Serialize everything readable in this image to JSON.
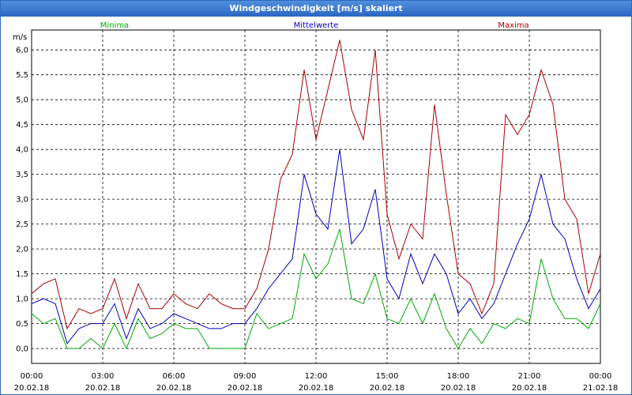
{
  "window": {
    "title": "Windgeschwindigkeit [m/s] skaliert"
  },
  "colors": {
    "minima": "#00aa00",
    "mittel": "#0000bb",
    "maxima": "#aa0000",
    "titlebar": "#2a66c3"
  },
  "chart_data": {
    "type": "line",
    "title": "Windgeschwindigkeit [m/s] skaliert",
    "ylabel": "m/s",
    "xlabel": "",
    "ylim": [
      -0.3,
      6.4
    ],
    "xlim": [
      0,
      24
    ],
    "grid": true,
    "legend_position": "top",
    "y_ticks": [
      "0,0",
      "0,5",
      "1,0",
      "1,5",
      "2,0",
      "2,5",
      "3,0",
      "3,5",
      "4,0",
      "4,5",
      "5,0",
      "5,5",
      "6,0"
    ],
    "y_tick_values": [
      0,
      0.5,
      1.0,
      1.5,
      2.0,
      2.5,
      3.0,
      3.5,
      4.0,
      4.5,
      5.0,
      5.5,
      6.0
    ],
    "x_ticks": [
      {
        "time": "00:00",
        "date": "20.02.18"
      },
      {
        "time": "03:00",
        "date": "20.02.18"
      },
      {
        "time": "06:00",
        "date": "20.02.18"
      },
      {
        "time": "09:00",
        "date": "20.02.18"
      },
      {
        "time": "12:00",
        "date": "20.02.18"
      },
      {
        "time": "15:00",
        "date": "20.02.18"
      },
      {
        "time": "18:00",
        "date": "20.02.18"
      },
      {
        "time": "21:00",
        "date": "20.02.18"
      },
      {
        "time": "00:00",
        "date": "21.02.18"
      }
    ],
    "x_tick_values": [
      0,
      3,
      6,
      9,
      12,
      15,
      18,
      21,
      24
    ],
    "series": [
      {
        "name": "Minima",
        "x": [
          0,
          0.5,
          1,
          1.5,
          2,
          2.5,
          3,
          3.5,
          4,
          4.5,
          5,
          5.5,
          6,
          6.5,
          7,
          7.5,
          8,
          8.5,
          9,
          9.5,
          10,
          10.5,
          11,
          11.5,
          12,
          12.5,
          13,
          13.5,
          14,
          14.5,
          15,
          15.5,
          16,
          16.5,
          17,
          17.5,
          18,
          18.5,
          19,
          19.5,
          20,
          20.5,
          21,
          21.5,
          22,
          22.5,
          23,
          23.5,
          24
        ],
        "values": [
          0.7,
          0.5,
          0.6,
          0.0,
          0.0,
          0.2,
          0.0,
          0.5,
          0.0,
          0.6,
          0.2,
          0.3,
          0.5,
          0.4,
          0.4,
          0.0,
          0.0,
          0.0,
          0.0,
          0.7,
          0.4,
          0.5,
          0.6,
          1.9,
          1.4,
          1.7,
          2.4,
          1.0,
          0.9,
          1.5,
          0.6,
          0.5,
          1.0,
          0.5,
          1.1,
          0.4,
          0.0,
          0.4,
          0.1,
          0.5,
          0.4,
          0.6,
          0.5,
          1.8,
          1.0,
          0.6,
          0.6,
          0.4,
          0.9
        ]
      },
      {
        "name": "Mittelwerte",
        "x": [
          0,
          0.5,
          1,
          1.5,
          2,
          2.5,
          3,
          3.5,
          4,
          4.5,
          5,
          5.5,
          6,
          6.5,
          7,
          7.5,
          8,
          8.5,
          9,
          9.5,
          10,
          10.5,
          11,
          11.5,
          12,
          12.5,
          13,
          13.5,
          14,
          14.5,
          15,
          15.5,
          16,
          16.5,
          17,
          17.5,
          18,
          18.5,
          19,
          19.5,
          20,
          20.5,
          21,
          21.5,
          22,
          22.5,
          23,
          23.5,
          24
        ],
        "values": [
          0.9,
          1.0,
          0.9,
          0.1,
          0.4,
          0.5,
          0.5,
          0.9,
          0.2,
          0.8,
          0.4,
          0.5,
          0.7,
          0.6,
          0.5,
          0.4,
          0.4,
          0.5,
          0.5,
          0.8,
          1.2,
          1.5,
          1.8,
          3.5,
          2.7,
          2.4,
          4.0,
          2.1,
          2.4,
          3.2,
          1.4,
          1.0,
          1.9,
          1.3,
          1.9,
          1.5,
          0.7,
          1.0,
          0.6,
          0.9,
          1.5,
          2.1,
          2.6,
          3.5,
          2.5,
          2.2,
          1.4,
          0.8,
          1.2
        ]
      },
      {
        "name": "Maxima",
        "x": [
          0,
          0.5,
          1,
          1.5,
          2,
          2.5,
          3,
          3.5,
          4,
          4.5,
          5,
          5.5,
          6,
          6.5,
          7,
          7.5,
          8,
          8.5,
          9,
          9.5,
          10,
          10.5,
          11,
          11.5,
          12,
          12.5,
          13,
          13.5,
          14,
          14.5,
          15,
          15.5,
          16,
          16.5,
          17,
          17.5,
          18,
          18.5,
          19,
          19.5,
          20,
          20.5,
          21,
          21.5,
          22,
          22.5,
          23,
          23.5,
          24
        ],
        "values": [
          1.1,
          1.3,
          1.4,
          0.4,
          0.8,
          0.7,
          0.8,
          1.4,
          0.6,
          1.3,
          0.8,
          0.8,
          1.1,
          0.9,
          0.8,
          1.1,
          0.9,
          0.8,
          0.8,
          1.2,
          2.0,
          3.4,
          3.9,
          5.6,
          4.2,
          5.2,
          6.2,
          4.8,
          4.2,
          6.0,
          2.7,
          1.8,
          2.5,
          2.2,
          4.9,
          3.1,
          1.5,
          1.3,
          0.7,
          1.3,
          4.7,
          4.3,
          4.7,
          5.6,
          4.9,
          3.0,
          2.6,
          1.1,
          1.9
        ]
      }
    ]
  }
}
